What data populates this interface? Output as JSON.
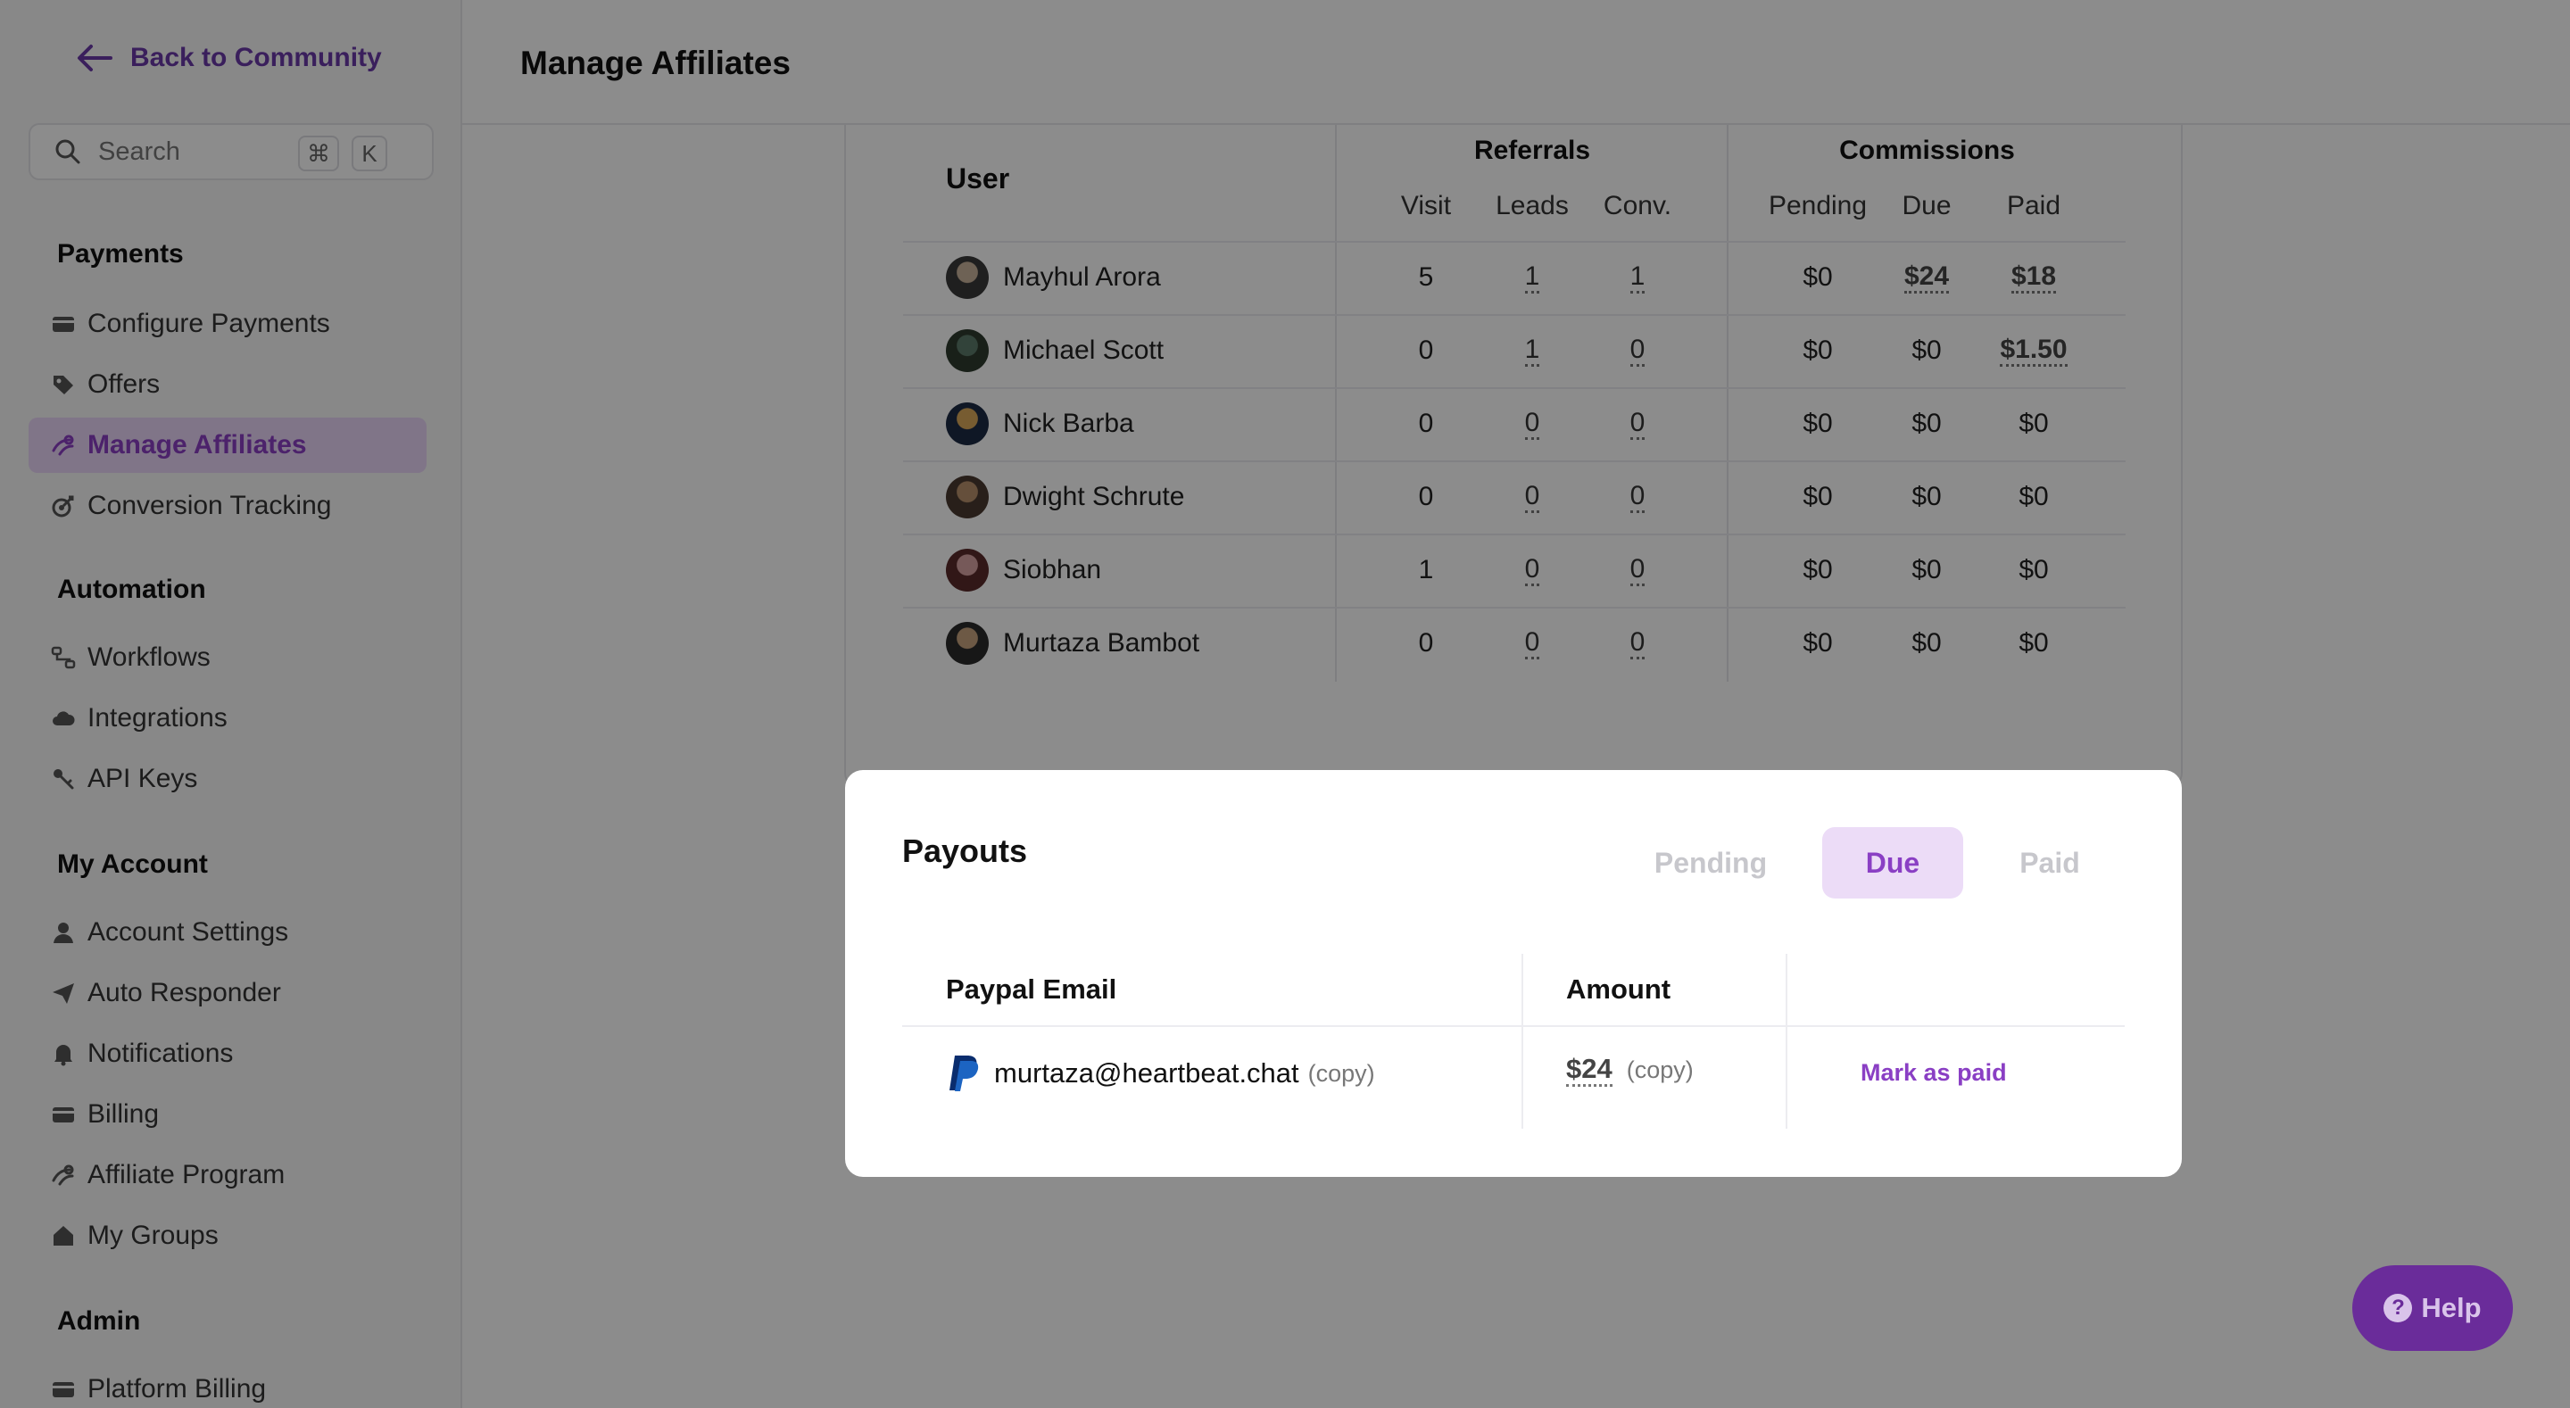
{
  "sidebar": {
    "back_label": "Back to Community",
    "search": {
      "placeholder": "Search",
      "kbd1": "⌘",
      "kbd2": "K"
    },
    "sections": {
      "payments": "Payments",
      "automation": "Automation",
      "my_account": "My Account",
      "admin": "Admin"
    },
    "items": {
      "configure_payments": "Configure Payments",
      "offers": "Offers",
      "manage_affiliates": "Manage Affiliates",
      "conversion_tracking": "Conversion Tracking",
      "workflows": "Workflows",
      "integrations": "Integrations",
      "api_keys": "API Keys",
      "account_settings": "Account Settings",
      "auto_responder": "Auto Responder",
      "notifications": "Notifications",
      "billing": "Billing",
      "affiliate_program": "Affiliate Program",
      "my_groups": "My Groups",
      "platform_billing": "Platform Billing"
    }
  },
  "header": {
    "title": "Manage Affiliates"
  },
  "affiliates": {
    "headers": {
      "user": "User",
      "referrals": "Referrals",
      "commissions": "Commissions",
      "visit": "Visit",
      "leads": "Leads",
      "conv": "Conv.",
      "pending": "Pending",
      "due": "Due",
      "paid": "Paid"
    },
    "rows": [
      {
        "name": "Mayhul Arora",
        "visit": "5",
        "leads": "1",
        "conv": "1",
        "pending": "$0",
        "due": "$24",
        "paid": "$18"
      },
      {
        "name": "Michael Scott",
        "visit": "0",
        "leads": "1",
        "conv": "0",
        "pending": "$0",
        "due": "$0",
        "paid": "$1.50"
      },
      {
        "name": "Nick Barba",
        "visit": "0",
        "leads": "0",
        "conv": "0",
        "pending": "$0",
        "due": "$0",
        "paid": "$0"
      },
      {
        "name": "Dwight Schrute",
        "visit": "0",
        "leads": "0",
        "conv": "0",
        "pending": "$0",
        "due": "$0",
        "paid": "$0"
      },
      {
        "name": "Siobhan",
        "visit": "1",
        "leads": "0",
        "conv": "0",
        "pending": "$0",
        "due": "$0",
        "paid": "$0"
      },
      {
        "name": "Murtaza Bambot",
        "visit": "0",
        "leads": "0",
        "conv": "0",
        "pending": "$0",
        "due": "$0",
        "paid": "$0"
      }
    ]
  },
  "payouts": {
    "title": "Payouts",
    "tabs": {
      "pending": "Pending",
      "due": "Due",
      "paid": "Paid"
    },
    "active_tab": "Due",
    "headers": {
      "email": "Paypal Email",
      "amount": "Amount"
    },
    "row": {
      "email": "murtaza@heartbeat.chat",
      "email_copy": "(copy)",
      "amount": "$24",
      "amount_copy": "(copy)",
      "action": "Mark as paid"
    }
  },
  "help": {
    "label": "Help"
  },
  "colors": {
    "accent": "#8a3fc4",
    "accent_bg": "#ecdcf7",
    "help_bg": "#6a2c9a"
  }
}
